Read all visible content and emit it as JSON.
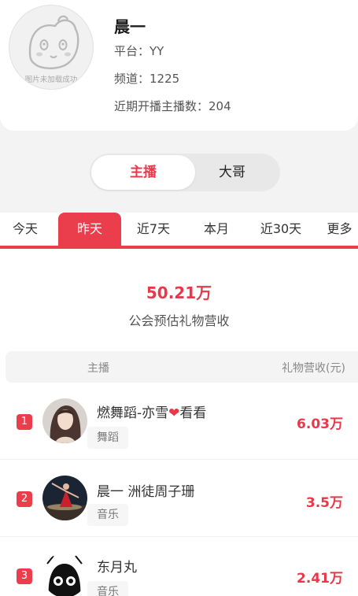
{
  "guild": {
    "avatar_fail_text": "图片未加载成功",
    "name": "晨一",
    "platform_label": "平台：",
    "platform_value": "YY",
    "channel_label": "频道：",
    "channel_value": "1225",
    "recent_anchors_label": "近期开播主播数：",
    "recent_anchors_value": "204"
  },
  "role_toggle": {
    "anchor": "主播",
    "boss": "大哥",
    "selected": "主播"
  },
  "period_tabs": [
    "今天",
    "昨天",
    "近7天",
    "本月",
    "近30天",
    "更多"
  ],
  "selected_period": "昨天",
  "summary": {
    "total_income": "50.21万",
    "total_label": "公会预估礼物营收"
  },
  "table": {
    "col_anchor": "主播",
    "col_income": "礼物营收(元)",
    "rows": [
      {
        "rank": "1",
        "name": "燃舞蹈-亦雪",
        "name_suffix": "看看",
        "has_heart": true,
        "tag": "舞蹈",
        "income": "6.03万"
      },
      {
        "rank": "2",
        "name": "晨一 洲徒周子珊",
        "name_suffix": "",
        "has_heart": false,
        "tag": "音乐",
        "income": "3.5万"
      },
      {
        "rank": "3",
        "name": "东月丸",
        "name_suffix": "",
        "has_heart": false,
        "tag": "音乐",
        "income": "2.41万"
      }
    ]
  },
  "colors": {
    "accent": "#e8384a",
    "tab_active": "#ea3e4c",
    "page_bg": "#f3f3f3"
  },
  "icons": {
    "guild_avatar": "broken-image-placeholder-icon",
    "heart": "red-heart-icon"
  }
}
